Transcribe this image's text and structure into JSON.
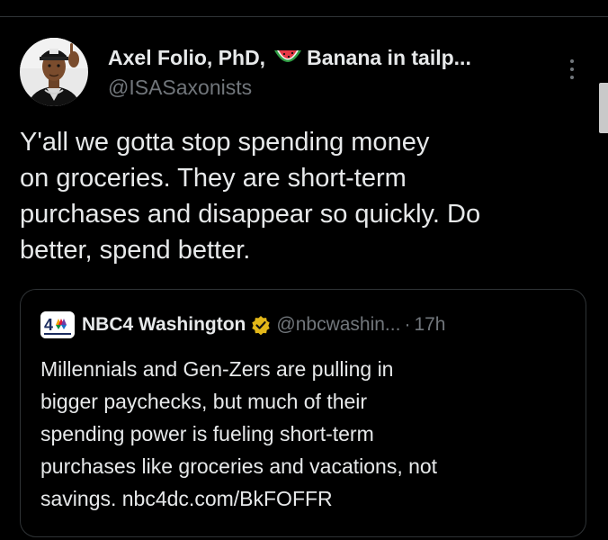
{
  "tweet": {
    "author_name": "Axel Folio, PhD,",
    "author_name_suffix": "Banana in tailp...",
    "handle": "@ISASaxonists",
    "name_emoji_icon": "watermelon-icon",
    "text": "Y'all we gotta stop spending money\non groceries. They are short-term\npurchases and disappear so quickly. Do\nbetter, spend better."
  },
  "quote": {
    "source_logo_icon": "nbc4-logo-icon",
    "name": "NBC4 Washington",
    "verified_icon": "verified-badge-icon",
    "handle": "@nbcwashin...",
    "separator": "·",
    "time": "17h",
    "text": "Millennials and Gen-Zers are pulling in\nbigger paychecks, but much of their\nspending power is fueling short-term\npurchases like groceries and vacations, not\nsavings. nbc4dc.com/BkFOFFR"
  },
  "colors": {
    "background": "#000000",
    "text_primary": "#e7e9ea",
    "text_secondary": "#71767b",
    "border": "#2f3336",
    "verified_gold": "#e2b719"
  }
}
